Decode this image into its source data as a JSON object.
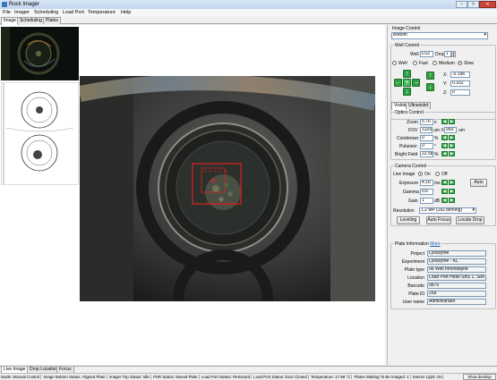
{
  "window": {
    "title": "Rock Imager",
    "controls": [
      "–",
      "□",
      "✕"
    ]
  },
  "menu": [
    "File",
    "Imager",
    "Scheduling",
    "Load Port",
    "Temperature",
    "Help"
  ],
  "top_tabs": [
    "Image",
    "Scheduling",
    "Plates"
  ],
  "bottom_tabs": [
    "Live Image",
    "Drop Location",
    "Focus"
  ],
  "image_control": {
    "title": "Image Control",
    "selected": "Bottom",
    "well_control": {
      "title": "Well Control",
      "well_label": "Well",
      "well_value": "D12",
      "drop_label": "Drop",
      "drop_value": "1",
      "speed_options": [
        "Well",
        "Fast",
        "Medium",
        "Slow"
      ],
      "speed_selected": "Slow",
      "x_label": "X:",
      "x_value": "-0.196",
      "y_label": "Y:",
      "y_value": "0.162",
      "z_label": "Z:",
      "z_value": "0"
    },
    "subtabs": [
      "Visible",
      "Ultraviolet"
    ],
    "optics": {
      "title": "Optics Control",
      "zoom_label": "Zoom",
      "zoom_value": "5.76",
      "zoom_unit": "x",
      "fov_label": "FOV",
      "fov_w": "1325",
      "fov_mid": "um X",
      "fov_h": "993",
      "fov_unit": "um",
      "condenser_label": "Condenser",
      "condenser_value": "0",
      "condenser_unit": "%",
      "polarizer_label": "Polarizer",
      "polarizer_value": "0",
      "polarizer_unit": "°",
      "brightfield_label": "Bright Field",
      "brightfield_value": "22.58",
      "brightfield_unit": "%"
    },
    "camera": {
      "title": "Camera Control",
      "live_label": "Live Image",
      "live_on": "On",
      "live_off": "Off",
      "exposure_label": "Exposure",
      "exposure_value": "4.16",
      "exposure_unit": "ms",
      "auto_label": "Auto",
      "gamma_label": "Gamma",
      "gamma_value": "0.6",
      "gain_label": "Gain",
      "gain_value": "1",
      "gain_unit": "dB",
      "resolution_label": "Resolution",
      "resolution_value": "1.2 MP (2x2 binning)",
      "leveling": "Leveling",
      "autofocus": "Auto Focus",
      "locate_drop": "Locate Drop"
    }
  },
  "plate_info": {
    "title": "Plate Information",
    "more": "More",
    "rows": [
      {
        "label": "Project",
        "value": "Lysozyme"
      },
      {
        "label": "Experiment",
        "value": "Lysozyme - KL"
      },
      {
        "label": "Plate type",
        "value": "96 Well Innovadyne"
      },
      {
        "label": "Location",
        "value": "Load Port Hotel SBS 1, Slot 3"
      },
      {
        "label": "Barcode",
        "value": "9876"
      },
      {
        "label": "Plate ID",
        "value": "259"
      },
      {
        "label": "User name",
        "value": "Administrator"
      }
    ]
  },
  "status": [
    "Mode: Manual Control",
    "Image Bottom Status: Aligned Plate",
    "Imager Top Status: Idle",
    "PSR Status: Moved Plate",
    "Load Port Status: Retracted",
    "Load Port Status: Door Closed",
    "Temperature: 17.88 °C",
    "Plates Waiting To Be Imaged: 1",
    "Interior Light: On"
  ],
  "show_desktop": "Show desktop",
  "colors": {
    "accent_green": "#2ea043",
    "roi_red": "#e11d1d",
    "titlebar": "#c3d6ee"
  }
}
